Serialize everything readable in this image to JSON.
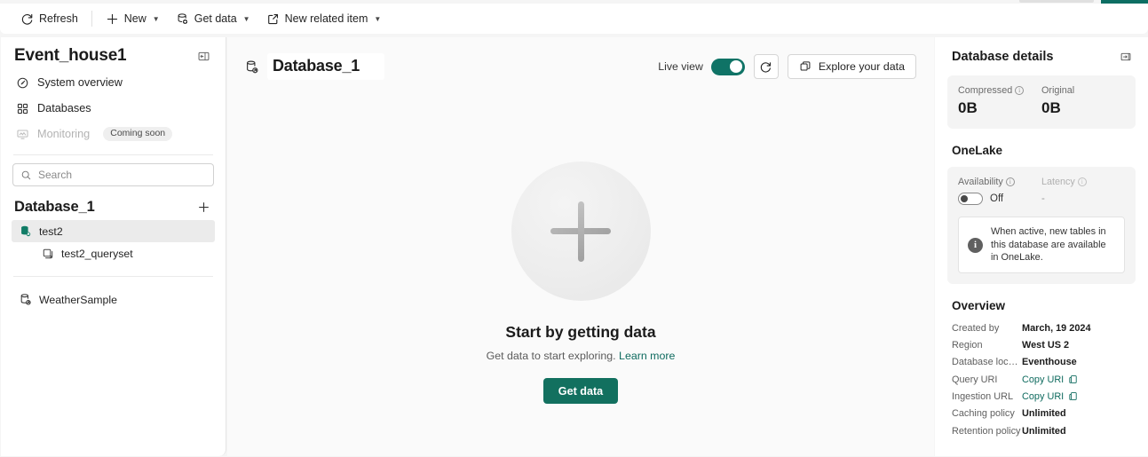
{
  "command_bar": {
    "refresh": "Refresh",
    "new": "New",
    "get_data": "Get data",
    "new_related_item": "New related item"
  },
  "sidebar": {
    "title": "Event_house1",
    "nav_items": [
      {
        "label": "System overview",
        "icon": "gauge-icon"
      },
      {
        "label": "Databases",
        "icon": "grid-icon"
      },
      {
        "label": "Monitoring",
        "icon": "monitor-icon",
        "badge": "Coming soon"
      }
    ],
    "search_placeholder": "Search",
    "search_value": "",
    "tree_header": "Database_1",
    "tree": [
      {
        "label": "test2",
        "icon": "database-icon",
        "selected": true
      },
      {
        "label": "test2_queryset",
        "icon": "queryset-icon",
        "selected": false
      },
      {
        "label": "WeatherSample",
        "icon": "database-icon",
        "selected": false
      }
    ]
  },
  "main": {
    "title": "Database_1",
    "live_view_label": "Live view",
    "live_view_on": true,
    "explore_button": "Explore your data",
    "empty_state": {
      "title": "Start by getting data",
      "subtitle": "Get data to start exploring.",
      "link": "Learn more",
      "button": "Get data"
    }
  },
  "details": {
    "title": "Database details",
    "stats": [
      {
        "label": "Compressed",
        "value": "0B",
        "has_info": true
      },
      {
        "label": "Original",
        "value": "0B",
        "has_info": false
      }
    ],
    "onelake": {
      "section_title": "OneLake",
      "availability_label": "Availability",
      "availability_value": "Off",
      "availability_on": false,
      "latency_label": "Latency",
      "latency_value": "-",
      "note": "When active, new tables in this database are available in OneLake."
    },
    "overview": {
      "section_title": "Overview",
      "rows": [
        {
          "key": "Created by",
          "value": "March, 19 2024",
          "type": "text"
        },
        {
          "key": "Region",
          "value": "West US 2",
          "type": "text"
        },
        {
          "key": "Database locati…",
          "value": "Eventhouse",
          "type": "text"
        },
        {
          "key": "Query URI",
          "value": "Copy URI",
          "type": "link"
        },
        {
          "key": "Ingestion URL",
          "value": "Copy URI",
          "type": "link"
        },
        {
          "key": "Caching policy",
          "value": "Unlimited",
          "type": "text"
        },
        {
          "key": "Retention policy",
          "value": "Unlimited",
          "type": "text"
        }
      ]
    }
  },
  "colors": {
    "accent_teal": "#12705f",
    "link_teal": "#0f6b5f",
    "toggle_on": "#0f7366"
  }
}
